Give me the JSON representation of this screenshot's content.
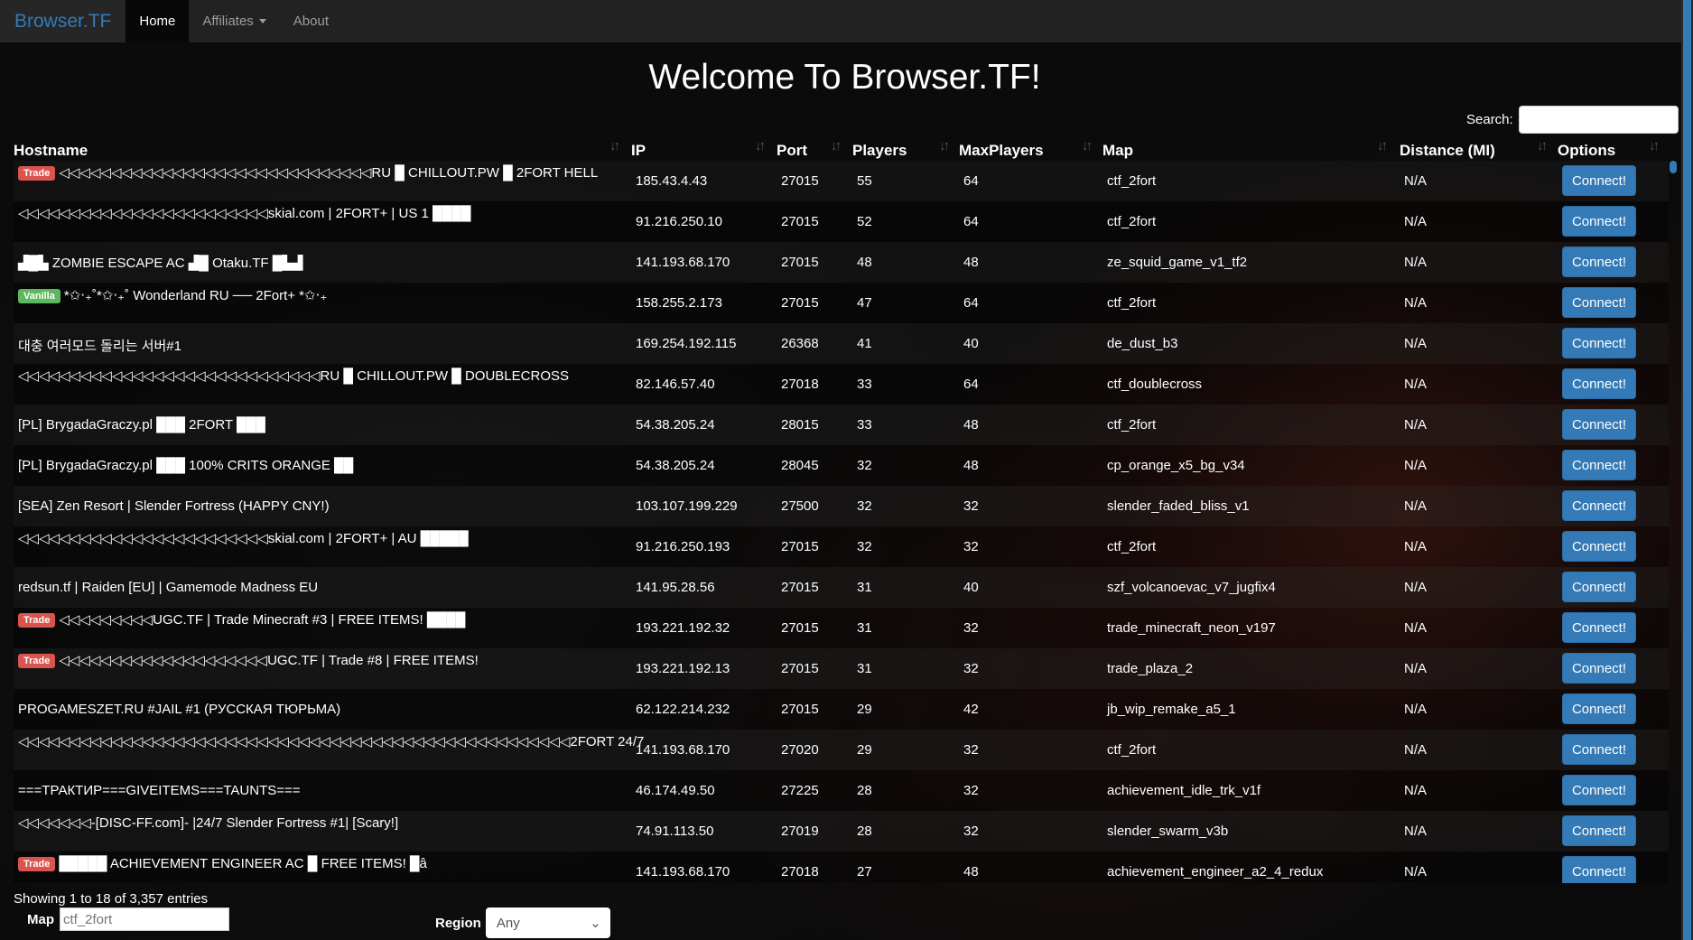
{
  "nav": {
    "brand": "Browser.TF",
    "items": [
      {
        "label": "Home",
        "active": true
      },
      {
        "label": "Affiliates",
        "dropdown": true
      },
      {
        "label": "About"
      }
    ]
  },
  "title": "Welcome To Browser.TF!",
  "search": {
    "label": "Search:",
    "value": ""
  },
  "columns": [
    "Hostname",
    "IP",
    "Port",
    "Players",
    "MaxPlayers",
    "Map",
    "Distance (MI)",
    "Options"
  ],
  "colors": {
    "trade": "#d9534f",
    "vanilla": "#5cb85c",
    "button": "#337ab7"
  },
  "rows": [
    {
      "badge": "Trade",
      "host": "◁◁◁◁◁◁◁◁◁◁◁◁◁◁◁◁◁◁◁◁◁◁◁◁◁◁◁◁◁◁RU █ CHILLOUT.PW █ 2FORT HELL",
      "ip": "185.43.4.43",
      "port": "27015",
      "players": "55",
      "max": "64",
      "map": "ctf_2fort",
      "dist": "N/A"
    },
    {
      "host": "◁◁◁◁◁◁◁◁◁◁◁◁◁◁◁◁◁◁◁◁◁◁◁◁skial.com | 2FORT+ | US 1 ████",
      "ip": "91.216.250.10",
      "port": "27015",
      "players": "52",
      "max": "64",
      "map": "ctf_2fort",
      "dist": "N/A"
    },
    {
      "host": "▟█▙ ZOMBIE ESCAPE AC ▟█ Otaku.TF █▙▟",
      "ip": "141.193.68.170",
      "port": "27015",
      "players": "48",
      "max": "48",
      "map": "ze_squid_game_v1_tf2",
      "dist": "N/A"
    },
    {
      "badge": "Vanilla",
      "host": "*✩‧₊˚*✩‧₊˚ Wonderland RU ── 2Fort+ *✩‧₊",
      "ip": "158.255.2.173",
      "port": "27015",
      "players": "47",
      "max": "64",
      "map": "ctf_2fort",
      "dist": "N/A"
    },
    {
      "host": "대충 여러모드 돌리는 서버#1",
      "ip": "169.254.192.115",
      "port": "26368",
      "players": "41",
      "max": "40",
      "map": "de_dust_b3",
      "dist": "N/A"
    },
    {
      "host": "◁◁◁◁◁◁◁◁◁◁◁◁◁◁◁◁◁◁◁◁◁◁◁◁◁◁◁◁◁RU █ CHILLOUT.PW █ DOUBLECROSS",
      "ip": "82.146.57.40",
      "port": "27018",
      "players": "33",
      "max": "64",
      "map": "ctf_doublecross",
      "dist": "N/A"
    },
    {
      "host": "[PL] BrygadaGraczy.pl ███ 2FORT ███",
      "ip": "54.38.205.24",
      "port": "28015",
      "players": "33",
      "max": "48",
      "map": "ctf_2fort",
      "dist": "N/A"
    },
    {
      "host": "[PL] BrygadaGraczy.pl ███ 100% CRITS ORANGE ██",
      "ip": "54.38.205.24",
      "port": "28045",
      "players": "32",
      "max": "48",
      "map": "cp_orange_x5_bg_v34",
      "dist": "N/A"
    },
    {
      "host": "[SEA] Zen Resort | Slender Fortress (HAPPY CNY!)",
      "ip": "103.107.199.229",
      "port": "27500",
      "players": "32",
      "max": "32",
      "map": "slender_faded_bliss_v1",
      "dist": "N/A"
    },
    {
      "host": "◁◁◁◁◁◁◁◁◁◁◁◁◁◁◁◁◁◁◁◁◁◁◁◁skial.com | 2FORT+ | AU █████",
      "ip": "91.216.250.193",
      "port": "27015",
      "players": "32",
      "max": "32",
      "map": "ctf_2fort",
      "dist": "N/A"
    },
    {
      "host": "redsun.tf | Raiden [EU] | Gamemode Madness EU",
      "ip": "141.95.28.56",
      "port": "27015",
      "players": "31",
      "max": "40",
      "map": "szf_volcanoevac_v7_jugfix4",
      "dist": "N/A"
    },
    {
      "badge": "Trade",
      "host": "◁◁◁◁◁◁◁◁◁UGC.TF | Trade Minecraft #3 | FREE ITEMS! ████",
      "ip": "193.221.192.32",
      "port": "27015",
      "players": "31",
      "max": "32",
      "map": "trade_minecraft_neon_v197",
      "dist": "N/A"
    },
    {
      "badge": "Trade",
      "host": "◁◁◁◁◁◁◁◁◁◁◁◁◁◁◁◁◁◁◁◁UGC.TF | Trade #8 | FREE ITEMS!",
      "ip": "193.221.192.13",
      "port": "27015",
      "players": "31",
      "max": "32",
      "map": "trade_plaza_2",
      "dist": "N/A"
    },
    {
      "host": "PROGAMESZET.RU #JAIL #1 (РУССКАЯ ТЮРЬМА)",
      "ip": "62.122.214.232",
      "port": "27015",
      "players": "29",
      "max": "42",
      "map": "jb_wip_remake_a5_1",
      "dist": "N/A"
    },
    {
      "host": "◁◁◁◁◁◁◁◁◁◁◁◁◁◁◁◁◁◁◁◁◁◁◁◁◁◁◁◁◁◁◁◁◁◁◁◁◁◁◁◁◁◁◁◁◁◁◁◁◁◁◁◁◁2FORT 24/7",
      "ip": "141.193.68.170",
      "port": "27020",
      "players": "29",
      "max": "32",
      "map": "ctf_2fort",
      "dist": "N/A"
    },
    {
      "host": "===ТРАКТИР===GIVEITEMS===TAUNTS===",
      "ip": "46.174.49.50",
      "port": "27225",
      "players": "28",
      "max": "32",
      "map": "achievement_idle_trk_v1f",
      "dist": "N/A"
    },
    {
      "host": "◁◁◁◁◁◁◁-[DISC-FF.com]- |24/7 Slender Fortress #1| [Scary!]",
      "ip": "74.91.113.50",
      "port": "27019",
      "players": "28",
      "max": "32",
      "map": "slender_swarm_v3b",
      "dist": "N/A"
    },
    {
      "badge": "Trade",
      "host": "█████ ACHIEVEMENT ENGINEER AC █ FREE ITEMS! █â",
      "ip": "141.193.68.170",
      "port": "27018",
      "players": "27",
      "max": "48",
      "map": "achievement_engineer_a2_4_redux",
      "dist": "N/A"
    }
  ],
  "connect_label": "Connect!",
  "info": "Showing 1 to 18 of 3,357 entries",
  "filters": {
    "map_label": "Map",
    "map_placeholder": "ctf_2fort",
    "region_label": "Region",
    "region_value": "Any"
  }
}
